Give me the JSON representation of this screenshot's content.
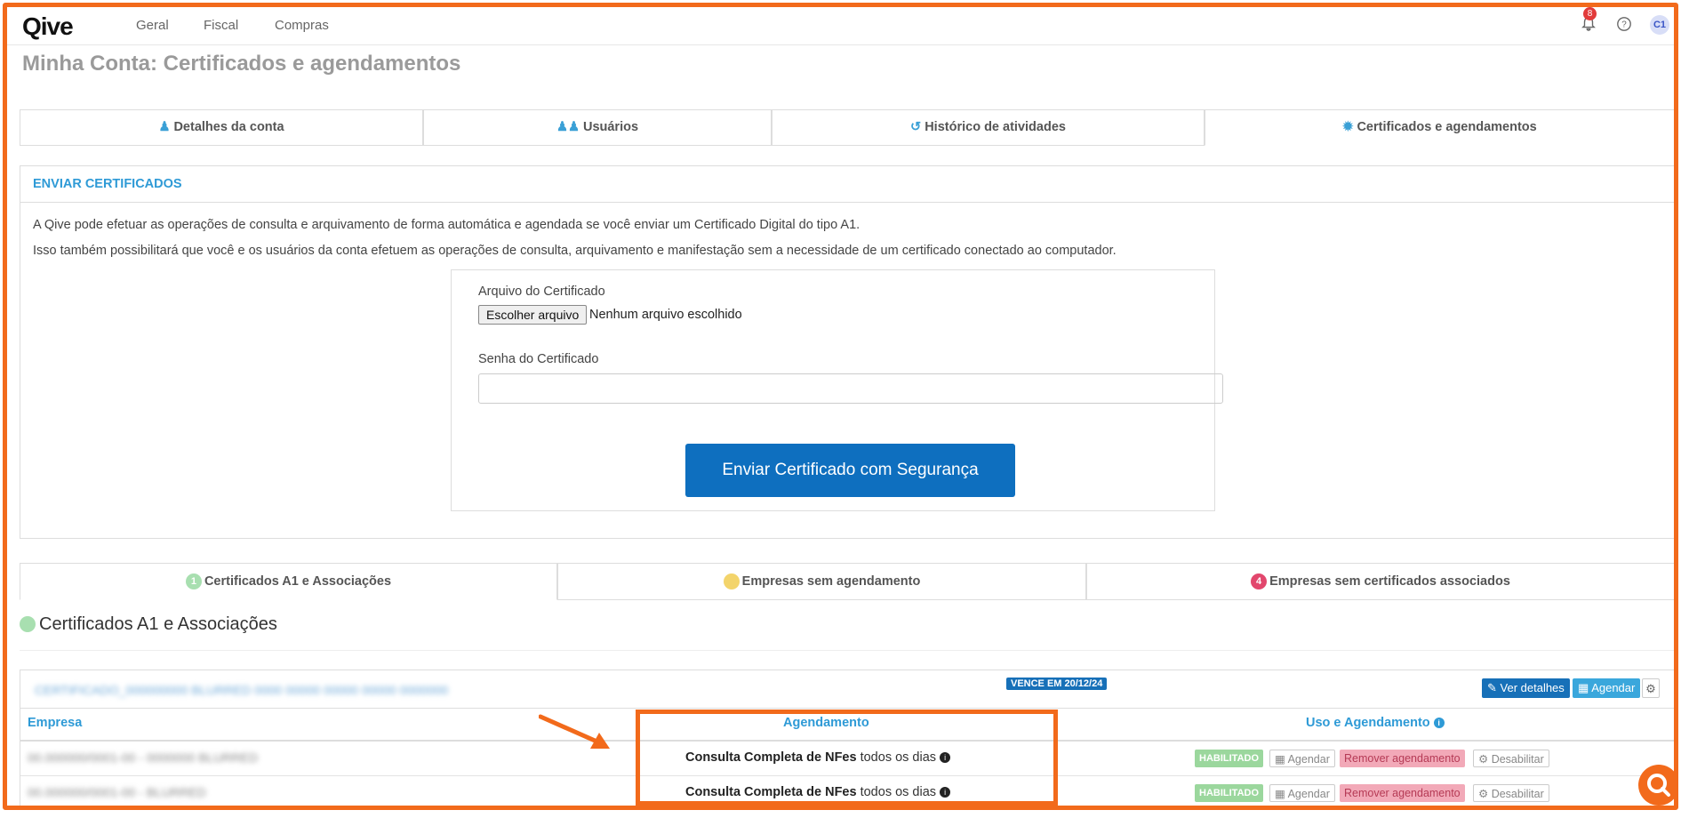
{
  "brand": "Qive",
  "nav": [
    "Geral",
    "Fiscal",
    "Compras"
  ],
  "notifications_count": "8",
  "avatar": "C1",
  "page_title": "Minha Conta: Certificados e agendamentos",
  "tabs": [
    {
      "label": "Detalhes da conta",
      "icon": "user-icon"
    },
    {
      "label": "Usuários",
      "icon": "users-icon"
    },
    {
      "label": "Histórico de atividades",
      "icon": "history-icon"
    },
    {
      "label": "Certificados e agendamentos",
      "icon": "gear-icon"
    }
  ],
  "upload": {
    "title": "ENVIAR CERTIFICADOS",
    "text1": "A Qive pode efetuar as operações de consulta e arquivamento de forma automática e agendada se você enviar um Certificado Digital do tipo A1.",
    "text2": "Isso também possibilitará que você e os usuários da conta efetuem as operações de consulta, arquivamento e manifestação sem a necessidade de um certificado conectado ao computador.",
    "file_label": "Arquivo do Certificado",
    "file_button": "Escolher arquivo",
    "file_status": "Nenhum arquivo escolhido",
    "password_label": "Senha do Certificado",
    "submit": "Enviar Certificado com Segurança"
  },
  "subtabs": [
    {
      "badge": "1",
      "label": "Certificados A1 e Associações",
      "color": "#a8dfb0"
    },
    {
      "badge": "",
      "label": "Empresas sem agendamento",
      "color": "#f3d46b"
    },
    {
      "badge": "4",
      "label": "Empresas sem certificados associados",
      "color": "#e2476d"
    }
  ],
  "section_title": "Certificados A1 e Associações",
  "certificate": {
    "name": "CERTIFICADO_000000000 BLURRED 0000 00000 00000 00000 0000000",
    "expiry": "VENCE EM 20/12/24",
    "btn_details": "Ver detalhes",
    "btn_schedule": "Agendar",
    "columns": [
      "Empresa",
      "Agendamento",
      "Uso e Agendamento"
    ],
    "rows": [
      {
        "empresa": "00.000000/0001-00 - 0000000 BLURRED",
        "sched_bold": "Consulta Completa de NFes",
        "sched_rest": "todos os dias",
        "status": "HABILITADO",
        "agendar": "Agendar",
        "remover": "Remover agendamento",
        "desabilitar": "Desabilitar"
      },
      {
        "empresa": "00.000000/0001-00 - BLURRED",
        "sched_bold": "Consulta Completa de NFes",
        "sched_rest": "todos os dias",
        "status": "HABILITADO",
        "agendar": "Agendar",
        "remover": "Remover agendamento",
        "desabilitar": "Desabilitar"
      }
    ]
  }
}
